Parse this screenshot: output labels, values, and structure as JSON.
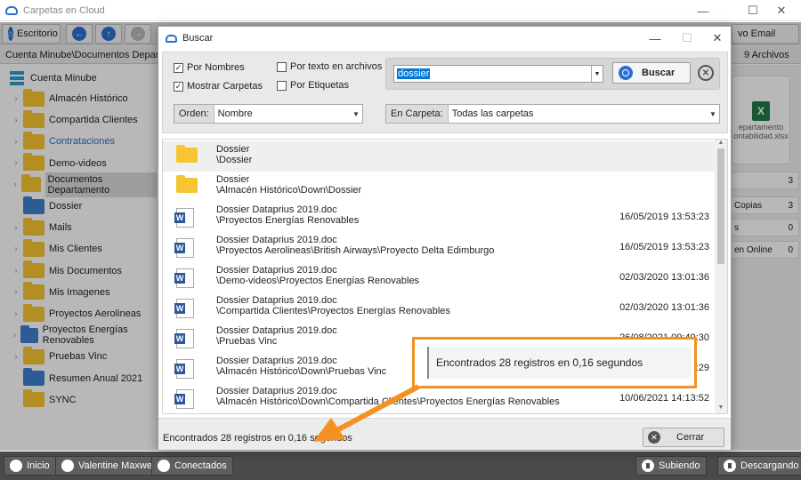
{
  "window": {
    "title": "Carpetas en Cloud"
  },
  "toolbar": {
    "desktop_label": "Escritorio",
    "email_label": "vo Email"
  },
  "pathbar": {
    "path": "Cuenta Minube\\Documentos Departament",
    "file_count": "9 Archivos"
  },
  "tree": {
    "root": "Cuenta Minube",
    "items": [
      {
        "label": "Almacén Histórico",
        "color": "yellow",
        "chevron": true
      },
      {
        "label": "Compartida Clientes",
        "color": "yellow",
        "chevron": true
      },
      {
        "label": "Contrataciones",
        "color": "yellow",
        "chevron": true,
        "highlight": true
      },
      {
        "label": "Demo-videos",
        "color": "yellow",
        "chevron": true
      },
      {
        "label": "Documentos Departamento",
        "color": "yellow",
        "chevron": true,
        "selected": true
      },
      {
        "label": "Dossier",
        "color": "blue",
        "chevron": false
      },
      {
        "label": "Mails",
        "color": "yellow",
        "chevron": true
      },
      {
        "label": "Mis Clientes",
        "color": "yellow",
        "chevron": true
      },
      {
        "label": "Mis Documentos",
        "color": "yellow",
        "chevron": true
      },
      {
        "label": "Mis Imagenes",
        "color": "yellow",
        "chevron": true
      },
      {
        "label": "Proyectos Aerolineas",
        "color": "yellow",
        "chevron": true
      },
      {
        "label": "Proyectos Energías Renovables",
        "color": "blue",
        "chevron": true
      },
      {
        "label": "Pruebas Vinc",
        "color": "yellow",
        "chevron": true
      },
      {
        "label": "Resumen Anual 2021",
        "color": "blue",
        "chevron": false
      },
      {
        "label": "SYNC",
        "color": "yellow",
        "chevron": false
      }
    ]
  },
  "right_panel": {
    "file_name_line1": "epartamento",
    "file_name_line2": "ontabilidad.xlsx",
    "stats": [
      {
        "label": "",
        "value": "3"
      },
      {
        "label": "Copias",
        "value": "3"
      },
      {
        "label": "s",
        "value": "0"
      },
      {
        "label": "en Online",
        "value": "0"
      }
    ]
  },
  "statusbar": {
    "inicio": "Inicio",
    "user": "Valentine Maxwell",
    "status": "Conectados",
    "upload": "Subiendo",
    "download": "Descargando"
  },
  "dialog": {
    "title": "Buscar",
    "options": {
      "by_names": "Por Nombres",
      "show_folders": "Mostrar Carpetas",
      "by_text": "Por texto en archivos",
      "by_tags": "Por Etiquetas"
    },
    "order": {
      "label": "Orden:",
      "value": "Nombre"
    },
    "folder": {
      "label": "En Carpeta:",
      "value": "Todas las carpetas"
    },
    "search": {
      "value": "dossier",
      "button": "Buscar"
    },
    "results": [
      {
        "type": "folder",
        "name": "Dossier",
        "path": "\\Dossier",
        "date": ""
      },
      {
        "type": "folder",
        "name": "Dossier",
        "path": "\\Almacén Histórico\\Down\\Dossier",
        "date": ""
      },
      {
        "type": "doc",
        "name": "Dossier Dataprius 2019.doc",
        "path": "\\Proyectos Energías Renovables",
        "date": "16/05/2019 13:53:23"
      },
      {
        "type": "doc",
        "name": "Dossier Dataprius 2019.doc",
        "path": "\\Proyectos Aerolineas\\British Airways\\Proyecto Delta Edimburgo",
        "date": "16/05/2019 13:53:23"
      },
      {
        "type": "doc",
        "name": "Dossier Dataprius 2019.doc",
        "path": "\\Demo-videos\\Proyectos Energías Renovables",
        "date": "02/03/2020 13:01:36"
      },
      {
        "type": "doc",
        "name": "Dossier Dataprius 2019.doc",
        "path": "\\Compartida Clientes\\Proyectos Energías Renovables",
        "date": "02/03/2020 13:01:36"
      },
      {
        "type": "doc",
        "name": "Dossier Dataprius 2019.doc",
        "path": "\\Pruebas Vinc",
        "date": "26/08/2021 09:49:30"
      },
      {
        "type": "doc",
        "name": "Dossier Dataprius 2019.doc",
        "path": "\\Almacén Histórico\\Down\\Pruebas Vinc",
        "date": ":29"
      },
      {
        "type": "doc",
        "name": "Dossier Dataprius 2019.doc",
        "path": "\\Almacén Histórico\\Down\\Compartida Clientes\\Proyectos Energías Renovables",
        "date": "10/06/2021 14:13:52"
      }
    ],
    "footer_status": "Encontrados 28 registros en 0,16 segundos",
    "close_button": "Cerrar"
  },
  "callout": {
    "text": "Encontrados 28 registros en 0,16 segundos"
  },
  "colors": {
    "accent": "#2a6fd0",
    "callout": "#f39222",
    "folder_yellow": "#f7c531",
    "folder_blue": "#3f7fd0"
  }
}
